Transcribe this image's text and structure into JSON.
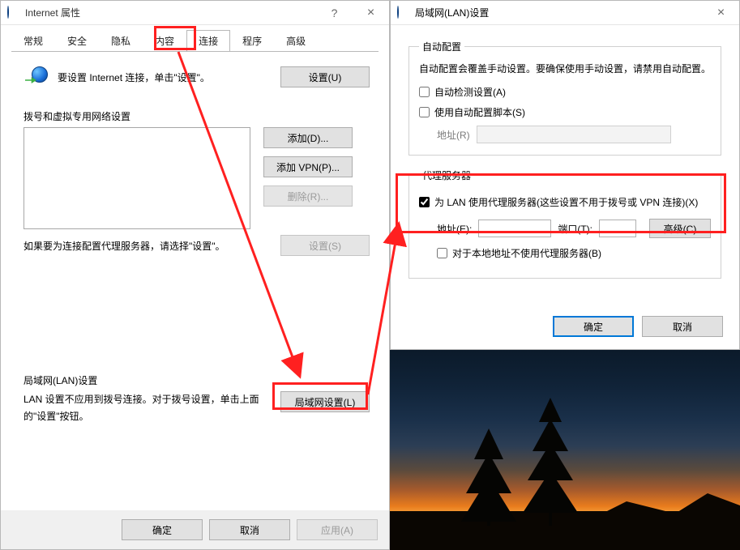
{
  "leftDialog": {
    "title": "Internet 属性",
    "helpGlyph": "?",
    "closeGlyph": "×",
    "tabs": [
      "常规",
      "安全",
      "隐私",
      "内容",
      "连接",
      "程序",
      "高级"
    ],
    "activeTabIndex": 4,
    "setupText": "要设置 Internet 连接，单击\"设置\"。",
    "setupButton": "设置(U)",
    "dialSection": {
      "label": "拨号和虚拟专用网络设置",
      "addButton": "添加(D)...",
      "addVpnButton": "添加 VPN(P)...",
      "removeButton": "删除(R)...",
      "hint": "如果要为连接配置代理服务器，请选择\"设置\"。",
      "settingsButton": "设置(S)"
    },
    "lanSection": {
      "label": "局域网(LAN)设置",
      "hint": "LAN 设置不应用到拨号连接。对于拨号设置，单击上面的\"设置\"按钮。",
      "button": "局域网设置(L)"
    },
    "footer": {
      "ok": "确定",
      "cancel": "取消",
      "apply": "应用(A)"
    }
  },
  "rightDialog": {
    "title": "局域网(LAN)设置",
    "closeGlyph": "×",
    "autoConfig": {
      "legend": "自动配置",
      "note": "自动配置会覆盖手动设置。要确保使用手动设置，请禁用自动配置。",
      "autoDetect": "自动检测设置(A)",
      "useScript": "使用自动配置脚本(S)",
      "addrLabel": "地址(R)"
    },
    "proxy": {
      "legend": "代理服务器",
      "useProxy": "为 LAN 使用代理服务器(这些设置不用于拨号或 VPN 连接)(X)",
      "addrLabel": "地址(E):",
      "portLabel": "端口(T):",
      "advanced": "高级(C)",
      "bypassLocal": "对于本地地址不使用代理服务器(B)"
    },
    "footer": {
      "ok": "确定",
      "cancel": "取消"
    }
  }
}
